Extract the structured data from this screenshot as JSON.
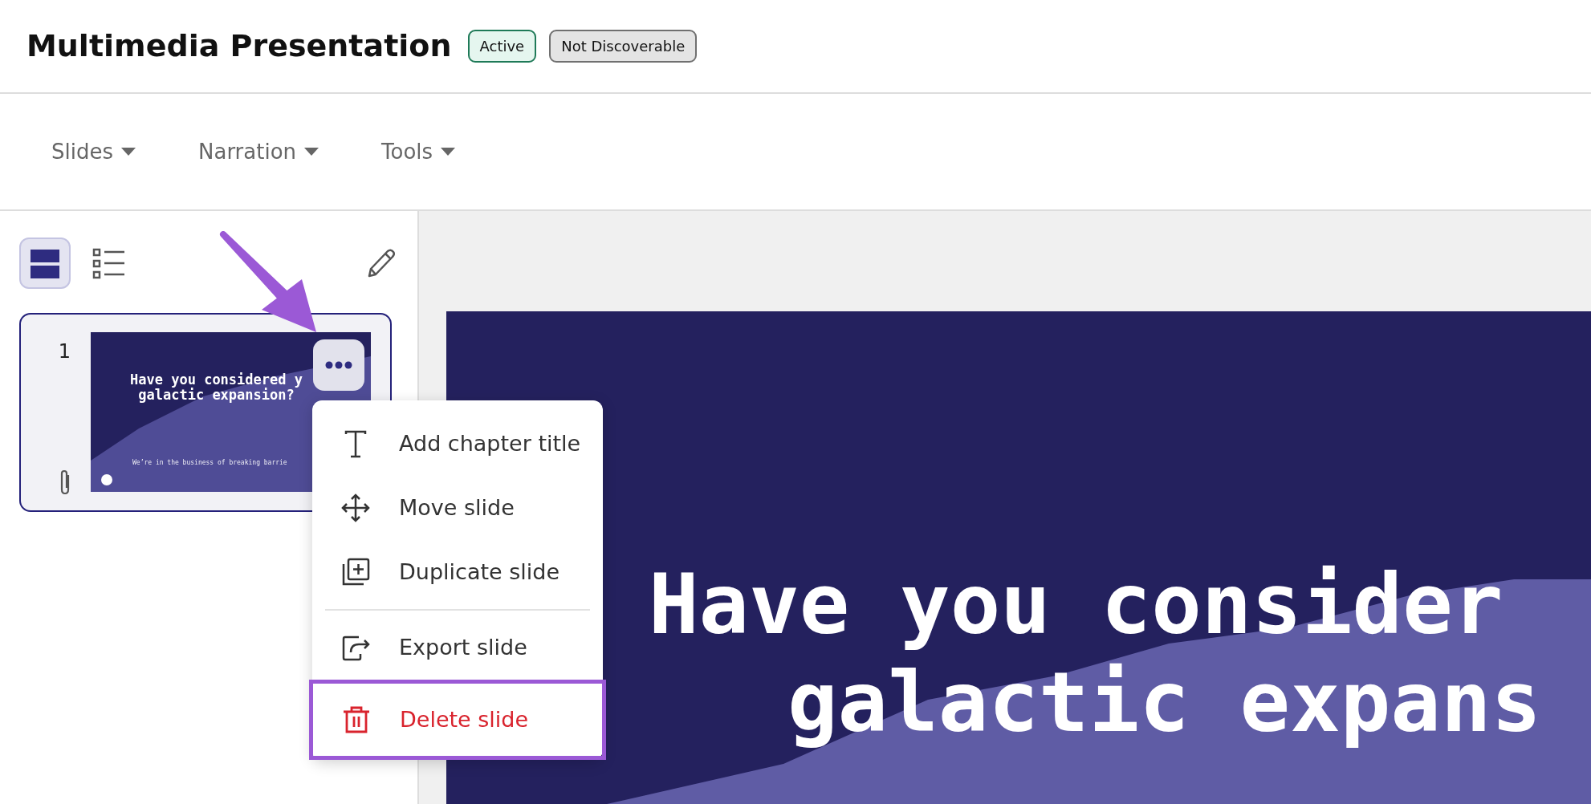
{
  "header": {
    "title": "Multimedia Presentation",
    "badges": [
      {
        "label": "Active",
        "kind": "success"
      },
      {
        "label": "Not Discoverable",
        "kind": "neutral"
      }
    ]
  },
  "toolbar": {
    "menus": [
      {
        "label": "Slides"
      },
      {
        "label": "Narration"
      },
      {
        "label": "Tools"
      }
    ]
  },
  "sidebar": {
    "view_toggles": [
      {
        "kind": "thumbnails",
        "selected": true
      },
      {
        "kind": "list",
        "selected": false
      }
    ],
    "slides": [
      {
        "number": "1",
        "selected": true,
        "title_lines": [
          "Have you considered y",
          "galactic expansion?"
        ],
        "subtitle": "We’re in the business of breaking barrie",
        "has_attachment": true
      }
    ]
  },
  "context_menu": {
    "items": [
      {
        "label": "Add chapter title",
        "kind": "chapter",
        "divider_before": false,
        "danger": false,
        "highlighted": false
      },
      {
        "label": "Move slide",
        "kind": "move",
        "divider_before": false,
        "danger": false,
        "highlighted": false
      },
      {
        "label": "Duplicate slide",
        "kind": "duplicate",
        "divider_before": false,
        "danger": false,
        "highlighted": false
      },
      {
        "label": "Export slide",
        "kind": "export",
        "divider_before": true,
        "danger": false,
        "highlighted": false
      },
      {
        "label": "Delete slide",
        "kind": "delete",
        "divider_before": false,
        "danger": true,
        "highlighted": true
      }
    ]
  },
  "slide_preview": {
    "title_lines": [
      "Have you consider",
      "galactic expans"
    ]
  }
}
